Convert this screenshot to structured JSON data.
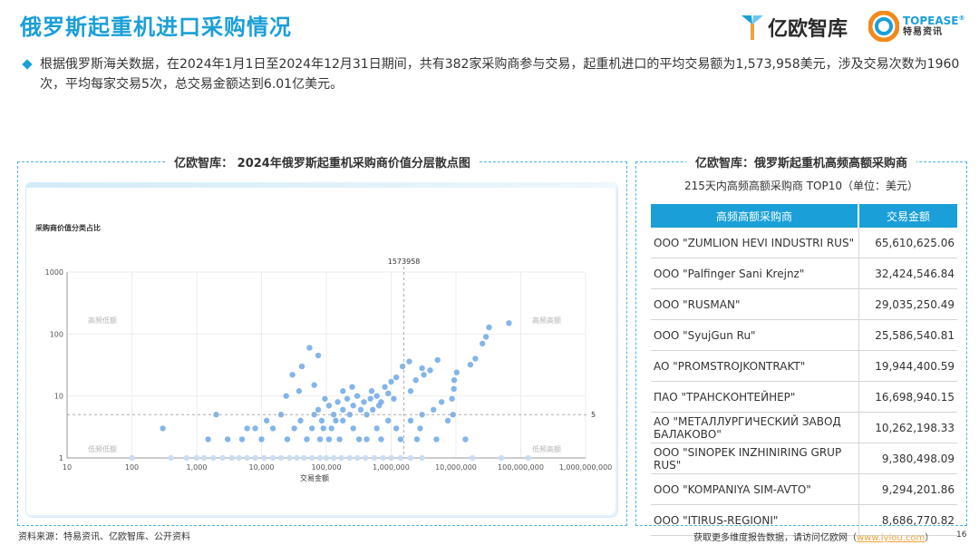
{
  "header": {
    "title": "俄罗斯起重机进口采购情况",
    "logo_yiou_text": "亿欧智库",
    "logo_topease_en": "TOPEASE",
    "logo_topease_cn": "特易资讯"
  },
  "summary": "根据俄罗斯海关数据，在2024年1月1日至2024年12月31日期间，共有382家采购商参与交易，起重机进口的平均交易额为1,573,958美元，涉及交易次数为1960次，平均每家交易5次，总交易金额达到6.01亿美元。",
  "left_panel": {
    "title": "亿欧智库： 2024年俄罗斯起重机采购商价值分层散点图"
  },
  "right_panel": {
    "title": "亿欧智库：俄罗斯起重机高频高额采购商",
    "subtitle": "215天内高频高额采购商 TOP10（单位：美元）"
  },
  "chart_data": [
    {
      "type": "scatter",
      "title": "采购商价值分类占比",
      "xlabel": "交易金额",
      "ylabel": "",
      "x_scale": "log",
      "y_scale": "log",
      "xlim": [
        10,
        1000000000
      ],
      "ylim": [
        1,
        1000
      ],
      "x_ticks": [
        "10",
        "100",
        "1,000",
        "10,000",
        "100,000",
        "1,000,000",
        "10,000,000",
        "100,000,000",
        "1,000,000,000"
      ],
      "y_ticks": [
        "1",
        "10",
        "100",
        "1000"
      ],
      "reference_lines": {
        "x": 1573958,
        "x_label": "1573958",
        "y": 5,
        "y_label": "5"
      },
      "quadrant_labels": {
        "top_left": "高频低额",
        "top_right": "高频高额",
        "bottom_left": "低频低额",
        "bottom_right": "低频高额"
      },
      "grid": true,
      "colors": {
        "point": "#6fa8e6",
        "point_light": "#c9dcf3",
        "axis": "#999999",
        "ref_line": "#aaaaaa"
      },
      "points": [
        [
          65610625,
          150
        ],
        [
          32424547,
          128
        ],
        [
          29035250,
          90
        ],
        [
          25586541,
          70
        ],
        [
          19944401,
          40
        ],
        [
          16698940,
          32
        ],
        [
          10262198,
          24
        ],
        [
          9380498,
          18
        ],
        [
          9294202,
          13
        ],
        [
          8686771,
          9
        ],
        [
          5200000,
          38
        ],
        [
          4000000,
          26
        ],
        [
          3200000,
          22
        ],
        [
          3000000,
          28
        ],
        [
          2400000,
          18
        ],
        [
          2000000,
          12
        ],
        [
          1900000,
          36
        ],
        [
          1500000,
          30
        ],
        [
          1200000,
          20
        ],
        [
          1000000,
          17
        ],
        [
          900000,
          11
        ],
        [
          1100000,
          9
        ],
        [
          800000,
          14
        ],
        [
          700000,
          8
        ],
        [
          650000,
          7
        ],
        [
          600000,
          10
        ],
        [
          520000,
          6
        ],
        [
          480000,
          9
        ],
        [
          420000,
          5
        ],
        [
          380000,
          8
        ],
        [
          340000,
          6
        ],
        [
          300000,
          10
        ],
        [
          260000,
          7
        ],
        [
          230000,
          5
        ],
        [
          210000,
          9
        ],
        [
          180000,
          6
        ],
        [
          150000,
          8
        ],
        [
          130000,
          5
        ],
        [
          110000,
          7
        ],
        [
          95000,
          9
        ],
        [
          85000,
          4
        ],
        [
          75000,
          6
        ],
        [
          65000,
          5
        ],
        [
          55000,
          60
        ],
        [
          75000,
          45
        ],
        [
          42000,
          30
        ],
        [
          30000,
          22
        ],
        [
          65000,
          15
        ],
        [
          38000,
          12
        ],
        [
          24000,
          10
        ],
        [
          180000,
          12
        ],
        [
          250000,
          14
        ],
        [
          500000,
          12
        ],
        [
          140000,
          4
        ],
        [
          120000,
          3
        ],
        [
          90000,
          3
        ],
        [
          60000,
          3
        ],
        [
          40000,
          4
        ],
        [
          32000,
          3
        ],
        [
          20000,
          5
        ],
        [
          15000,
          3
        ],
        [
          12000,
          4
        ],
        [
          8000,
          3
        ],
        [
          6000,
          3
        ],
        [
          2000,
          5
        ],
        [
          300,
          3
        ],
        [
          1500,
          2
        ],
        [
          3000,
          2
        ],
        [
          5000,
          2
        ],
        [
          10000,
          2
        ],
        [
          25000,
          2
        ],
        [
          50000,
          2
        ],
        [
          80000,
          2
        ],
        [
          160000,
          2
        ],
        [
          320000,
          2
        ],
        [
          700000,
          2
        ],
        [
          1400000,
          2
        ],
        [
          2500000,
          2
        ],
        [
          5000000,
          2
        ],
        [
          14000000,
          2
        ],
        [
          2000000,
          4
        ],
        [
          3000000,
          5
        ],
        [
          4500000,
          6
        ],
        [
          6000000,
          8
        ],
        [
          1200000,
          3
        ],
        [
          900000,
          4
        ],
        [
          600000,
          3
        ],
        [
          420000,
          2
        ],
        [
          260000,
          3
        ],
        [
          180000,
          4
        ],
        [
          110000,
          2
        ],
        [
          2800000,
          3
        ],
        [
          7500000,
          4
        ],
        [
          9000000,
          5
        ],
        [
          100,
          1
        ],
        [
          400,
          1
        ],
        [
          700,
          1
        ],
        [
          1000,
          1
        ],
        [
          1300,
          1
        ],
        [
          1800,
          1
        ],
        [
          2500,
          1
        ],
        [
          3500,
          1
        ],
        [
          4500,
          1
        ],
        [
          6000,
          1
        ],
        [
          8000,
          1
        ],
        [
          11000,
          1
        ],
        [
          15000,
          1
        ],
        [
          20000,
          1
        ],
        [
          27000,
          1
        ],
        [
          35000,
          1
        ],
        [
          45000,
          1
        ],
        [
          60000,
          1
        ],
        [
          80000,
          1
        ],
        [
          100000,
          1
        ],
        [
          130000,
          1
        ],
        [
          170000,
          1
        ],
        [
          230000,
          1
        ],
        [
          300000,
          1
        ],
        [
          400000,
          1
        ],
        [
          550000,
          1
        ],
        [
          750000,
          1
        ],
        [
          1000000,
          1
        ],
        [
          1400000,
          1
        ],
        [
          2000000,
          1
        ],
        [
          3000000,
          1
        ],
        [
          18000000,
          1
        ],
        [
          50000000,
          1
        ],
        [
          130000000,
          1
        ]
      ]
    },
    {
      "type": "table",
      "title": "215天内高频高额采购商 TOP10（单位：美元）",
      "columns": [
        "高频高额采购商",
        "交易金额"
      ],
      "rows": [
        [
          "OOO \"ZUMLION HEVI INDUSTRI RUS\"",
          "65,610,625.06"
        ],
        [
          "OOO \"Palfinger Sani Krejnz\"",
          "32,424,546.84"
        ],
        [
          "OOO \"RUSMAN\"",
          "29,035,250.49"
        ],
        [
          "OOO \"SyujGun Ru\"",
          "25,586,540.81"
        ],
        [
          "AO \"PROMSTROJKONTRAKT\"",
          "19,944,400.59"
        ],
        [
          "ПАО \"ТРАНСКОНТЕЙНЕР\"",
          "16,698,940.15"
        ],
        [
          "АО \"МЕТАЛЛУРГИЧЕСКИЙ ЗАВОД БАЛАКОВО\"",
          "10,262,198.33"
        ],
        [
          "OOO \"SINOPEK INZHINIRING GRUP RUS\"",
          "9,380,498.09"
        ],
        [
          "OOO \"KOMPANIYA SIM-AVTO\"",
          "9,294,201.86"
        ],
        [
          "OOO \"ITIRUS-REGIONI\"",
          "8,686,770.82"
        ]
      ]
    }
  ],
  "footer": {
    "source": "资料来源：特易资讯、亿欧智库、公开资料",
    "note": "获取更多维度报告数据，请访问亿欧网（",
    "url": "www.iyiou.com",
    "note_end": "）",
    "page": "16"
  }
}
